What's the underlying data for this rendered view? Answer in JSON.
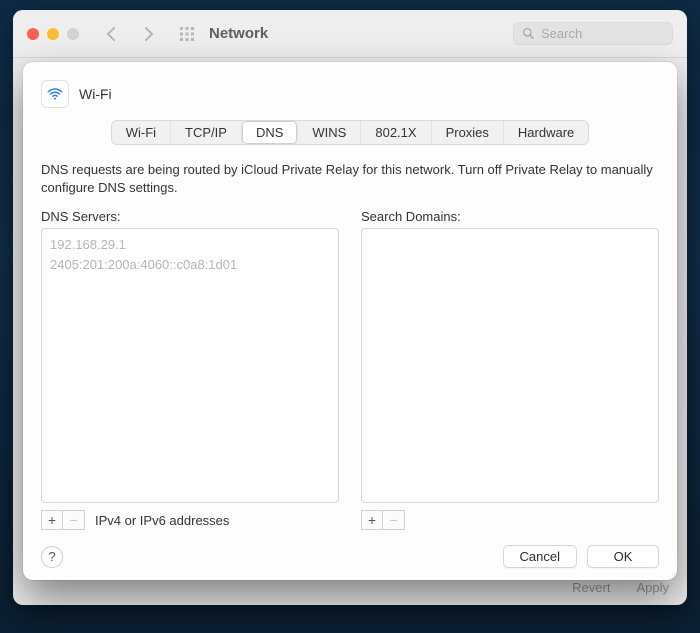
{
  "window": {
    "title": "Network",
    "search_placeholder": "Search",
    "footer": {
      "revert": "Revert",
      "apply": "Apply"
    }
  },
  "sheet": {
    "service_name": "Wi-Fi",
    "tabs": [
      "Wi-Fi",
      "TCP/IP",
      "DNS",
      "WINS",
      "802.1X",
      "Proxies",
      "Hardware"
    ],
    "active_tab": "DNS",
    "info_text": "DNS requests are being routed by iCloud Private Relay for this network. Turn off Private Relay to manually configure DNS settings.",
    "dns": {
      "label": "DNS Servers:",
      "servers": [
        "192.168.29.1",
        "2405:201:200a:4060::c0a8:1d01"
      ],
      "footer_hint": "IPv4 or IPv6 addresses"
    },
    "search_domains": {
      "label": "Search Domains:",
      "domains": []
    },
    "buttons": {
      "help": "?",
      "cancel": "Cancel",
      "ok": "OK"
    }
  }
}
